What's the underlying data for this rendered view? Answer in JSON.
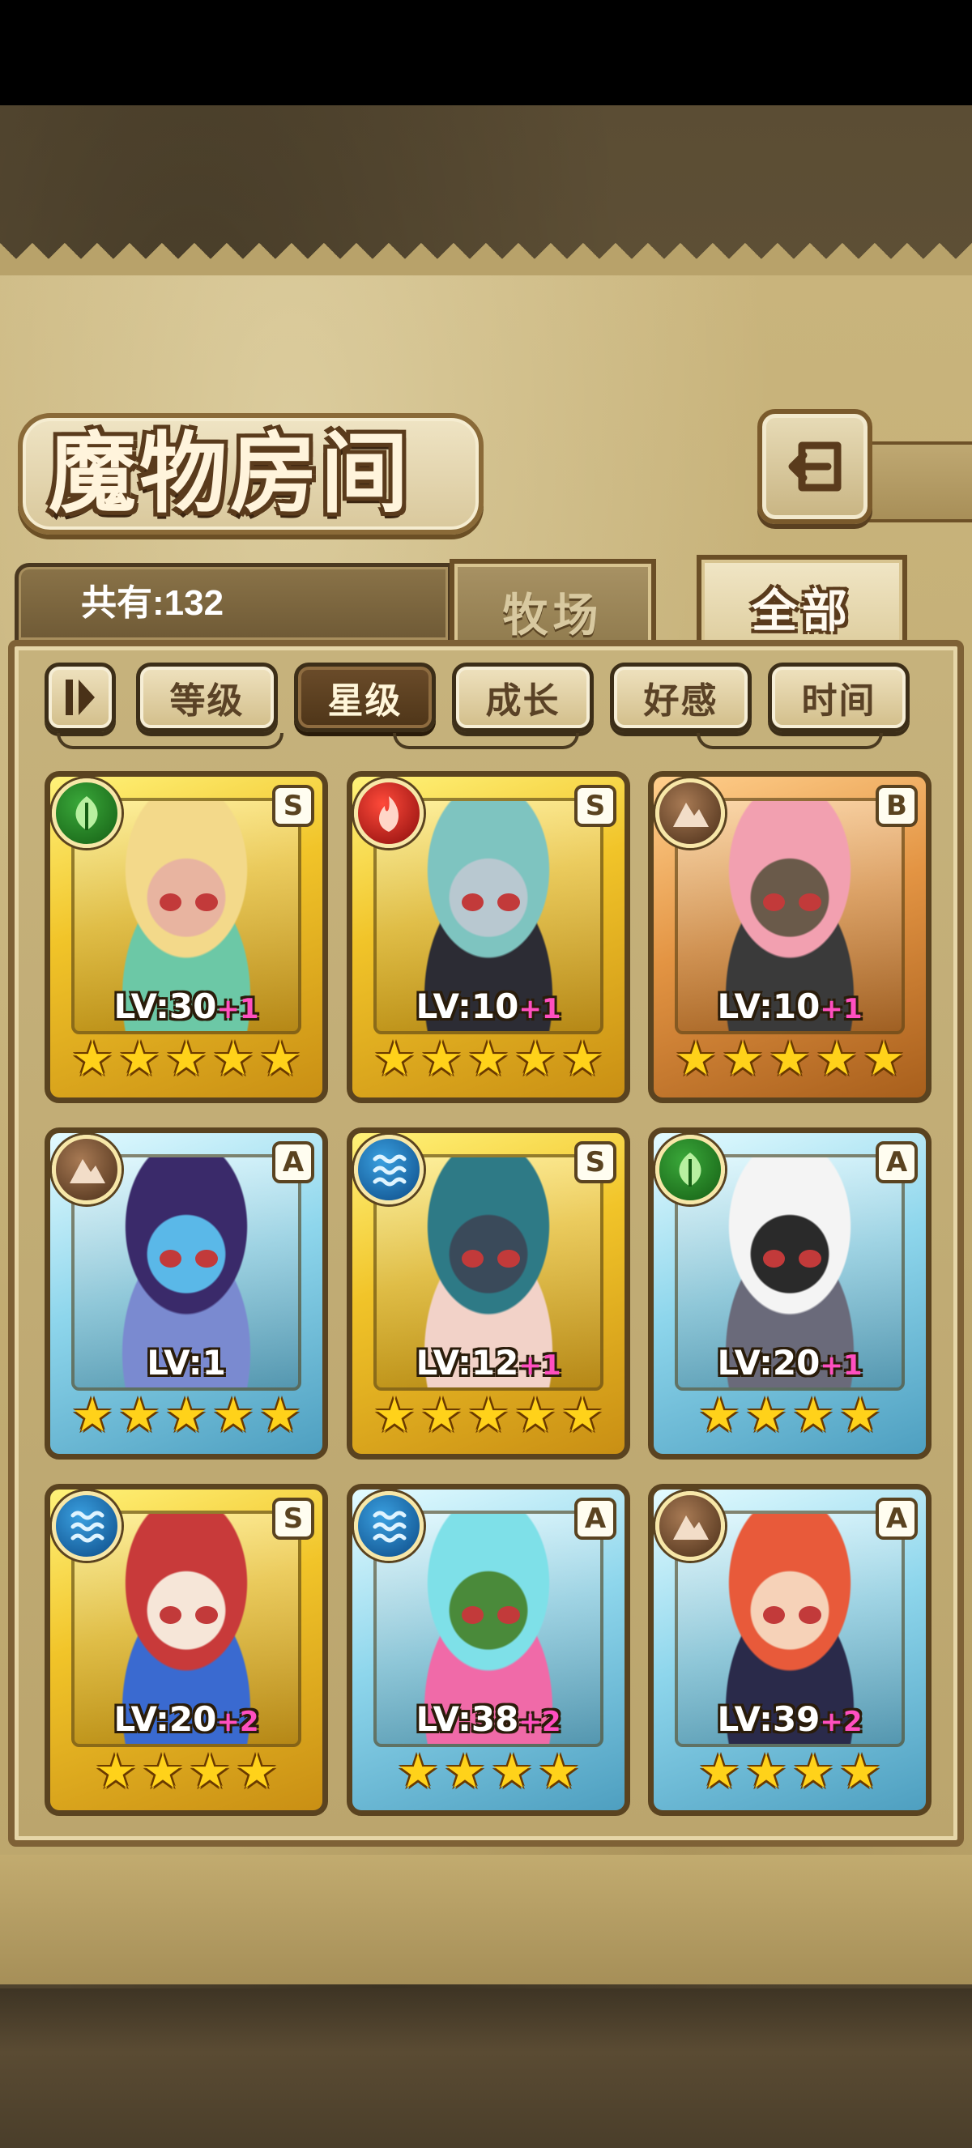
{
  "title": "魔物房间",
  "count_label": "共有:132",
  "tabs": [
    {
      "label": "牧场",
      "active": false
    },
    {
      "label": "全部",
      "active": true
    }
  ],
  "sort_buttons": [
    {
      "label": "等级",
      "active": false
    },
    {
      "label": "星级",
      "active": true
    },
    {
      "label": "成长",
      "active": false
    },
    {
      "label": "好感",
      "active": false
    },
    {
      "label": "时间",
      "active": false
    }
  ],
  "cards": [
    {
      "element": "leaf-icon",
      "rank": "S",
      "frame": "gold",
      "lv": "LV:30",
      "plus": "+1",
      "stars": 5,
      "palette": [
        "#f3d98a",
        "#6cc8a6",
        "#e8b4a0"
      ]
    },
    {
      "element": "fire-icon",
      "rank": "S",
      "frame": "gold",
      "lv": "LV:10",
      "plus": "+1",
      "stars": 5,
      "palette": [
        "#7ec4c0",
        "#2c2c34",
        "#b8c8d0"
      ]
    },
    {
      "element": "earth-icon",
      "rank": "B",
      "frame": "bronze",
      "lv": "LV:10",
      "plus": "+1",
      "stars": 5,
      "palette": [
        "#f2a0b0",
        "#3a3a3a",
        "#6a5a4a"
      ]
    },
    {
      "element": "earth-icon",
      "rank": "A",
      "frame": "blue",
      "lv": "LV:1",
      "plus": "",
      "stars": 5,
      "palette": [
        "#3a2a6a",
        "#7a8ad0",
        "#5ab8e8"
      ]
    },
    {
      "element": "water-icon",
      "rank": "S",
      "frame": "gold",
      "lv": "LV:12",
      "plus": "+1",
      "stars": 5,
      "palette": [
        "#2e7a86",
        "#f2d2c8",
        "#3a4a5a"
      ]
    },
    {
      "element": "leaf-icon",
      "rank": "A",
      "frame": "blue",
      "lv": "LV:20",
      "plus": "+1",
      "stars": 4,
      "palette": [
        "#f4f4f4",
        "#6a6a7a",
        "#2a2a2a"
      ]
    },
    {
      "element": "water-icon",
      "rank": "S",
      "frame": "gold",
      "lv": "LV:20",
      "plus": "+2",
      "stars": 4,
      "palette": [
        "#c83a3a",
        "#3a6ad0",
        "#f6e6d8"
      ]
    },
    {
      "element": "water-icon",
      "rank": "A",
      "frame": "blue",
      "lv": "LV:38",
      "plus": "+2",
      "stars": 4,
      "palette": [
        "#7ee0e8",
        "#f06aa8",
        "#4a8a3a"
      ]
    },
    {
      "element": "earth-icon",
      "rank": "A",
      "frame": "blue",
      "lv": "LV:39",
      "plus": "+2",
      "stars": 4,
      "palette": [
        "#e85a3a",
        "#2a2a4a",
        "#f6d2b8"
      ]
    }
  ],
  "colors": {
    "gold_frame": "#f1c429",
    "bronze_frame": "#e39443",
    "blue_frame": "#8ed6ec",
    "plus_pink": "#ff4fc0",
    "star": "#ffd21a"
  }
}
